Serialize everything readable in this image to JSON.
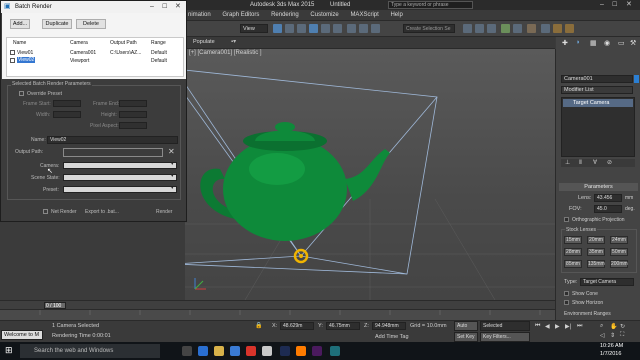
{
  "app": {
    "title": "Autodesk 3ds Max  2015",
    "file": "Untitled",
    "search_placeholder": "Type a keyword or phrase"
  },
  "menu": [
    "nimation",
    "Graph Editors",
    "Rendering",
    "Customize",
    "MAXScript",
    "Help"
  ],
  "toolbar": {
    "view_dropdown": "View",
    "selection_set": "Create Selection Se"
  },
  "ribbon": {
    "populate": "Populate"
  },
  "viewport": {
    "label": "[+] [Camera001] [Realistic ]"
  },
  "batch_render": {
    "title": "Batch Render",
    "buttons": {
      "add": "Add...",
      "duplicate": "Duplicate",
      "delete": "Delete"
    },
    "columns": [
      "Name",
      "Camera",
      "Output Path",
      "Range"
    ],
    "rows": [
      {
        "name": "View01",
        "camera": "Camera001",
        "output": "C:\\Users\\AZ...",
        "range": "Default"
      },
      {
        "name": "View02",
        "camera": "Viewport",
        "output": "",
        "range": "Default"
      }
    ],
    "group_title": "Selected Batch Render Parameters",
    "override_preset": "Override Preset",
    "frame_start": "Frame Start:",
    "frame_end": "Frame End:",
    "width": "Width:",
    "height": "Height:",
    "pixel_aspect": "Pixel Aspect:",
    "name_label": "Name:",
    "name_value": "View02",
    "output_path": "Output Path:",
    "camera": "Camera:",
    "scene_state": "Scene State:",
    "preset": "Preset:",
    "net_render": "Net Render",
    "export": "Export to .bat...",
    "render": "Render"
  },
  "command_panel": {
    "object_name": "Camera001",
    "modifier_list": "Modifier List",
    "stack_item": "Target Camera",
    "rollout": "Parameters",
    "lens_label": "Lens:",
    "lens_value": "43.456",
    "lens_unit": "mm",
    "fov_label": "FOV:",
    "fov_value": "45.0",
    "fov_unit": "deg.",
    "ortho": "Orthographic Projection",
    "stock_lenses": "Stock Lenses",
    "lenses": [
      "15mm",
      "20mm",
      "24mm",
      "28mm",
      "35mm",
      "50mm",
      "85mm",
      "135mm",
      "200mm"
    ],
    "type_label": "Type:",
    "type_value": "Target Camera",
    "show_cone": "Show Cone",
    "show_horizon": "Show Horizon",
    "env_ranges": "Environment Ranges"
  },
  "timeline": {
    "frame": "0 / 100"
  },
  "status": {
    "selection": "1 Camera Selected",
    "render_time": "Rendering Time  0:00:01",
    "welcome": "Welcome to M",
    "x_label": "X:",
    "x": "48.629m",
    "y_label": "Y:",
    "y": "46.75mm",
    "z_label": "Z:",
    "z": "94.948mm",
    "grid": "Grid = 10.0mm",
    "add_time_tag": "Add Time Tag",
    "auto_key": "Auto Key",
    "set_key": "Set Key",
    "selected": "Selected",
    "key_filters": "Key Filters..."
  },
  "taskbar": {
    "search": "Search the web and Windows",
    "time": "10:26 AM",
    "date": "1/7/2016"
  },
  "colors": {
    "teapot": "#0e8a3a",
    "frustum": "#9fb8d8",
    "accent": "#3a6ea5"
  }
}
